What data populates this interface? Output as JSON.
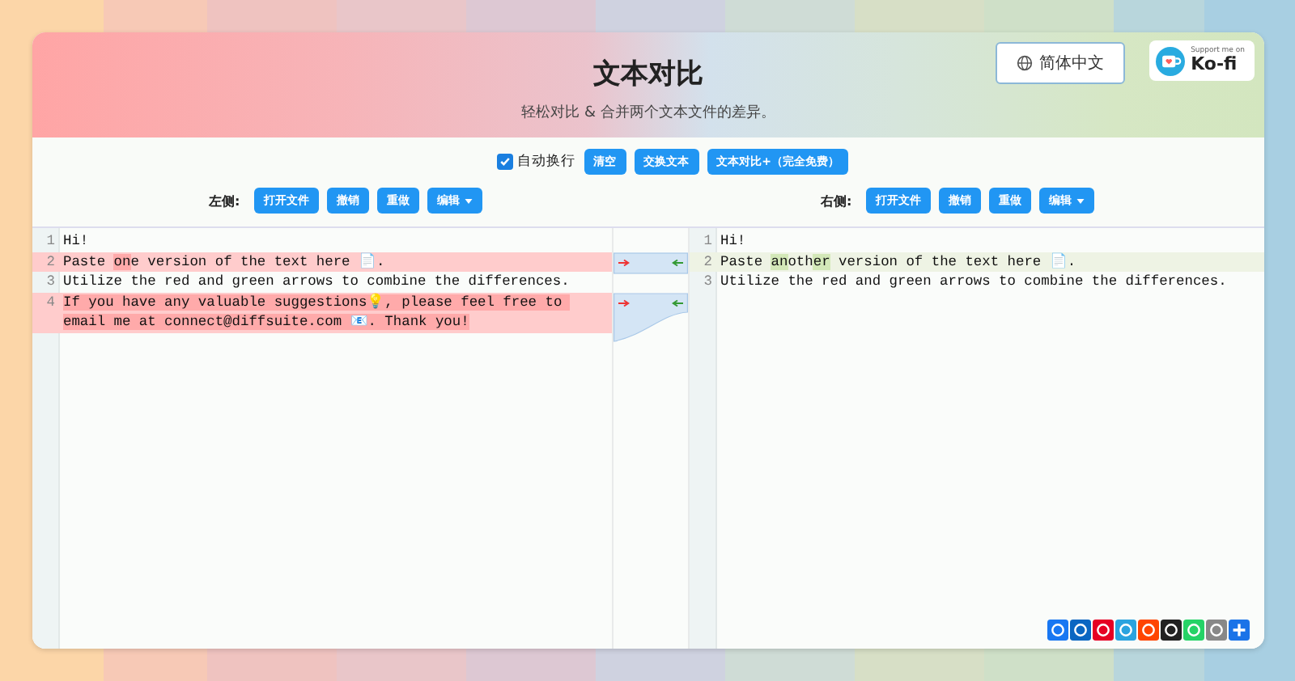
{
  "header": {
    "title": "文本对比",
    "subtitle": "轻松对比 & 合并两个文本文件的差异。",
    "language_button": "简体中文",
    "kofi": {
      "small": "Support me on",
      "brand": "Ko-fi"
    }
  },
  "toolbar": {
    "auto_wrap": {
      "label": "自动换行",
      "checked": true
    },
    "buttons": [
      "清空",
      "交换文本",
      "文本对比+（完全免费）"
    ]
  },
  "left_panel": {
    "label": "左侧:",
    "buttons": [
      "打开文件",
      "撤销",
      "重做",
      "编辑"
    ]
  },
  "right_panel": {
    "label": "右侧:",
    "buttons": [
      "打开文件",
      "撤销",
      "重做",
      "编辑"
    ]
  },
  "left_editor": {
    "lines": [
      {
        "number": "1",
        "kind": "same",
        "segments": [
          {
            "text": "Hi!",
            "changed": false
          }
        ]
      },
      {
        "number": "2",
        "kind": "removed",
        "segments": [
          {
            "text": "Paste ",
            "changed": false
          },
          {
            "text": "on",
            "changed": true
          },
          {
            "text": "e version of the text here 📄.",
            "changed": false
          }
        ]
      },
      {
        "number": "3",
        "kind": "same",
        "segments": [
          {
            "text": "Utilize the red and green arrows to combine the differences.",
            "changed": false
          }
        ]
      },
      {
        "number": "4",
        "kind": "removed",
        "segments": [
          {
            "text": "If you have any valuable suggestions💡, please feel free to email me at connect@diffsuite.com 📧. Thank you!",
            "changed": true
          }
        ]
      }
    ]
  },
  "right_editor": {
    "lines": [
      {
        "number": "1",
        "kind": "same",
        "segments": [
          {
            "text": "Hi!",
            "changed": false
          }
        ]
      },
      {
        "number": "2",
        "kind": "added",
        "segments": [
          {
            "text": "Paste ",
            "changed": false
          },
          {
            "text": "an",
            "changed": true
          },
          {
            "text": "oth",
            "changed": false
          },
          {
            "text": "er",
            "changed": true
          },
          {
            "text": " version of the text here 📄.",
            "changed": false
          }
        ]
      },
      {
        "number": "3",
        "kind": "same",
        "segments": [
          {
            "text": "Utilize the red and green arrows to combine the differences.",
            "changed": false
          }
        ]
      }
    ]
  }
}
